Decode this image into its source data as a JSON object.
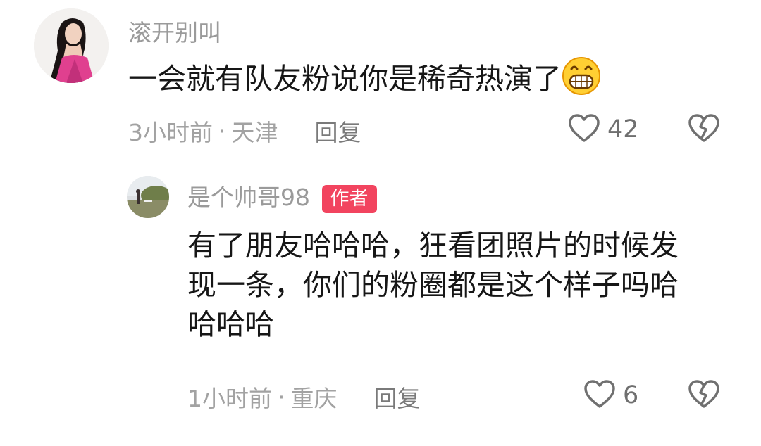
{
  "comments": [
    {
      "username": "滚开别叫",
      "text": "一会就有队友粉说你是稀奇热演了",
      "emoji": "grinning-face-emoji",
      "time": "3小时前",
      "location": "天津",
      "separator": "·",
      "reply_label": "回复",
      "likes": "42"
    },
    {
      "username": "是个帅哥98",
      "badge": "作者",
      "text_lines": [
        "有了朋友哈哈哈，狂看团照片的时候发",
        "现一条，你们的粉圈都是这个样子吗哈",
        "哈哈哈"
      ],
      "time": "1小时前",
      "location": "重庆",
      "separator": "·",
      "reply_label": "回复",
      "likes": "6"
    }
  ],
  "colors": {
    "badge": "#f2445f",
    "username": "#9a9a9a",
    "meta": "#a2a2a2"
  },
  "icons": [
    "heart-outline-icon",
    "broken-heart-icon"
  ]
}
